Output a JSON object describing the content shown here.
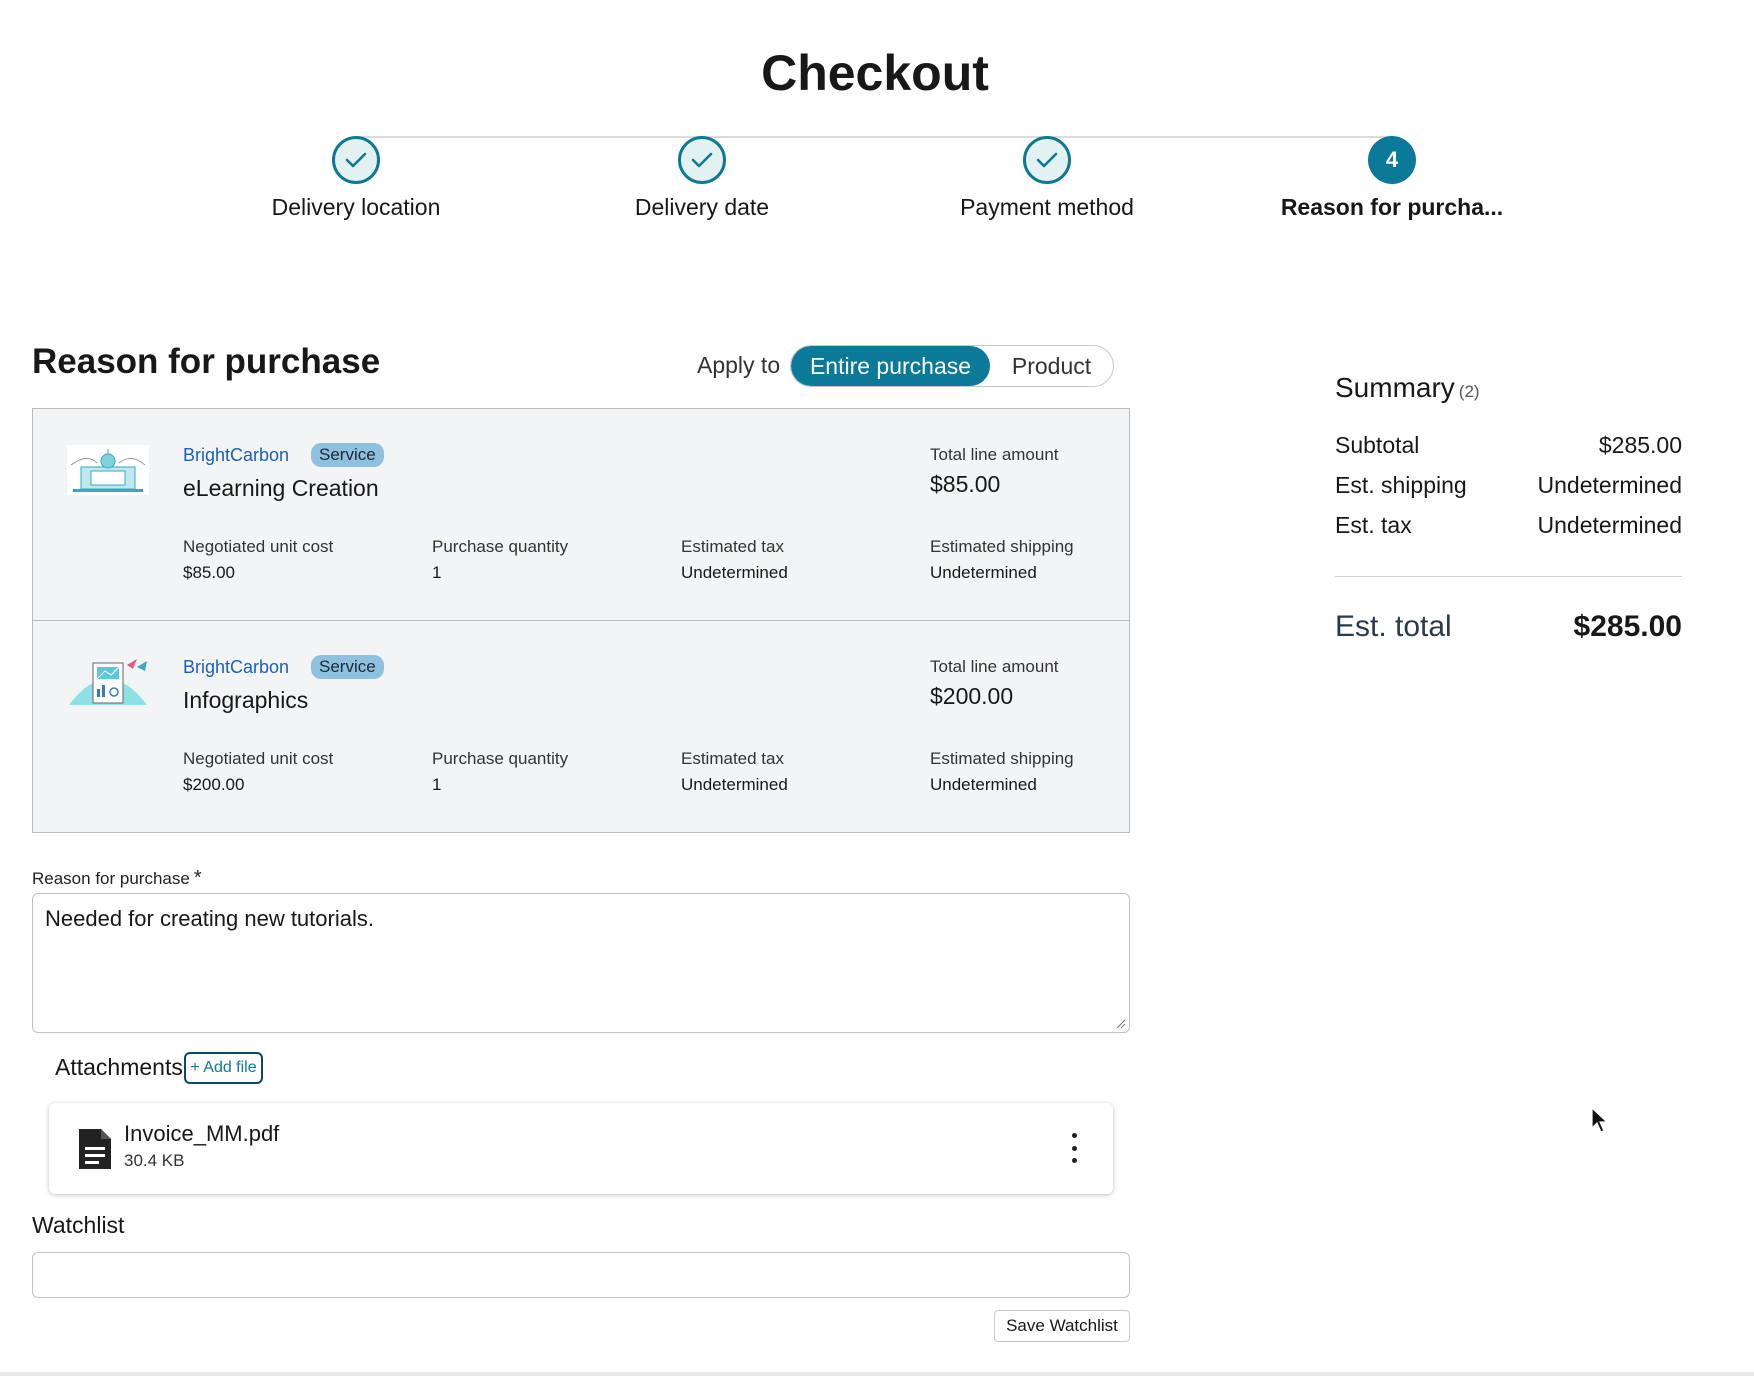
{
  "page": {
    "title": "Checkout"
  },
  "stepper": {
    "steps": [
      {
        "label": "Delivery location",
        "status": "complete"
      },
      {
        "label": "Delivery date",
        "status": "complete"
      },
      {
        "label": "Payment method",
        "status": "complete"
      },
      {
        "label": "Reason for purcha...",
        "status": "current",
        "number": "4"
      }
    ]
  },
  "reason_section": {
    "title": "Reason for purchase",
    "apply_to_label": "Apply to",
    "toggle": {
      "options": [
        "Entire purchase",
        "Product"
      ],
      "selected": "Entire purchase"
    }
  },
  "items": [
    {
      "vendor": "BrightCarbon",
      "badge": "Service",
      "name": "eLearning Creation",
      "total_label": "Total line amount",
      "total": "$85.00",
      "unit_cost_label": "Negotiated unit cost",
      "unit_cost": "$85.00",
      "qty_label": "Purchase quantity",
      "qty": "1",
      "tax_label": "Estimated tax",
      "tax": "Undetermined",
      "shipping_label": "Estimated shipping",
      "shipping": "Undetermined"
    },
    {
      "vendor": "BrightCarbon",
      "badge": "Service",
      "name": "Infographics",
      "total_label": "Total line amount",
      "total": "$200.00",
      "unit_cost_label": "Negotiated unit cost",
      "unit_cost": "$200.00",
      "qty_label": "Purchase quantity",
      "qty": "1",
      "tax_label": "Estimated tax",
      "tax": "Undetermined",
      "shipping_label": "Estimated shipping",
      "shipping": "Undetermined"
    }
  ],
  "reason_field": {
    "label": "Reason for purchase",
    "required_mark": "*",
    "value": "Needed for creating new tutorials."
  },
  "attachments": {
    "label": "Attachments",
    "add_button": "+ Add file",
    "files": [
      {
        "name": "Invoice_MM.pdf",
        "size": "30.4 KB"
      }
    ]
  },
  "watchlist": {
    "label": "Watchlist",
    "value": "",
    "save_button": "Save Watchlist"
  },
  "summary": {
    "title": "Summary",
    "count": "(2)",
    "subtotal_label": "Subtotal",
    "subtotal": "$285.00",
    "shipping_label": "Est. shipping",
    "shipping": "Undetermined",
    "tax_label": "Est. tax",
    "tax": "Undetermined",
    "total_label": "Est. total",
    "total": "$285.00"
  },
  "colors": {
    "accent": "#0b7a99",
    "link": "#1c5fb8",
    "badge_bg": "#8fc0de",
    "panel_bg": "#f2f4f6"
  },
  "icons": [
    "check-icon",
    "elearning-thumbnail",
    "infographics-thumbnail",
    "document-icon",
    "more-vertical-icon",
    "mouse-cursor"
  ]
}
